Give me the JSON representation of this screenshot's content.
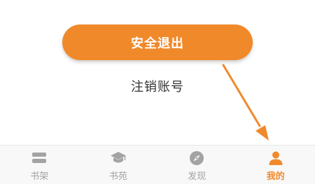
{
  "actions": {
    "logout_label": "安全退出",
    "cancel_account_label": "注销账号"
  },
  "tabbar": {
    "tabs": [
      {
        "label": "书架",
        "icon": "bookshelf-icon",
        "active": false
      },
      {
        "label": "书苑",
        "icon": "graduation-cap-icon",
        "active": false
      },
      {
        "label": "发现",
        "icon": "compass-icon",
        "active": false
      },
      {
        "label": "我的",
        "icon": "user-icon",
        "active": true
      }
    ]
  },
  "colors": {
    "accent": "#f0892a",
    "inactive_tab": "#a3a3a3",
    "text": "#333333",
    "tabbar_bg": "#f8f8f8"
  }
}
